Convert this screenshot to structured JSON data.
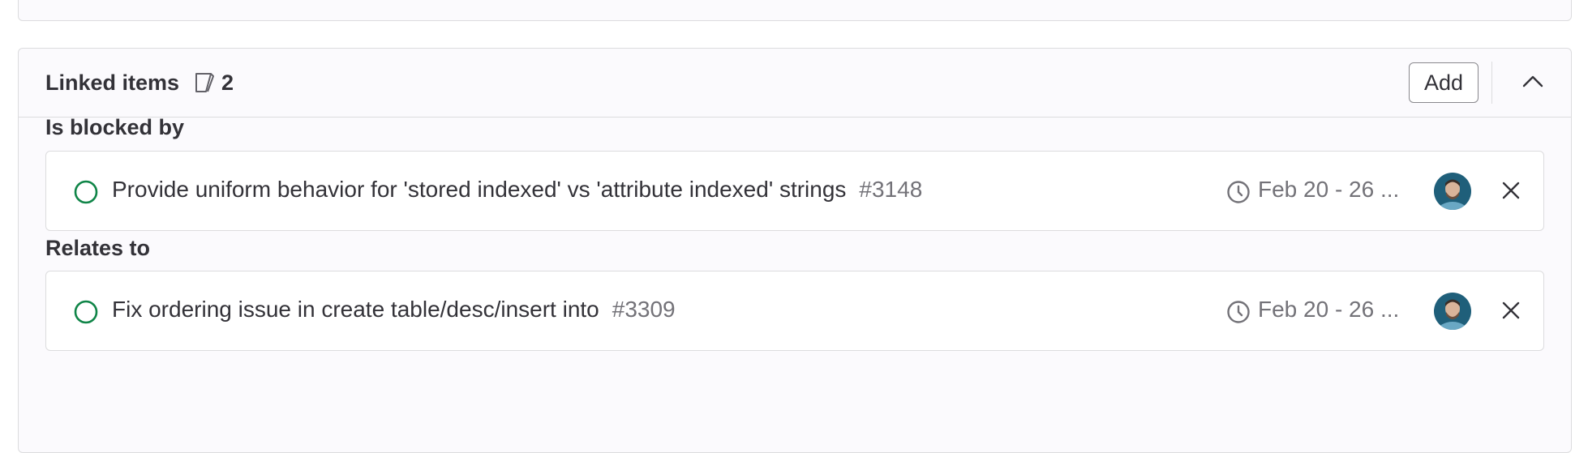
{
  "widget": {
    "title": "Linked items",
    "count": "2",
    "add_label": "Add",
    "count_icon": "issues-icon",
    "collapse_icon": "chevron-up-icon"
  },
  "sections": [
    {
      "title": "Is blocked by",
      "items": [
        {
          "title": "Provide uniform behavior for 'stored indexed' vs 'attribute indexed' strings",
          "reference": "#3148",
          "date": "Feb 20 - 26 ...",
          "status": "open",
          "status_color": "#108548"
        }
      ]
    },
    {
      "title": "Relates to",
      "items": [
        {
          "title": "Fix ordering issue in create table/desc/insert into",
          "reference": "#3309",
          "date": "Feb 20 - 26 ...",
          "status": "open",
          "status_color": "#108548"
        }
      ]
    }
  ],
  "colors": {
    "open_status": "#108548",
    "muted_text": "#737278",
    "border": "#dcdcde",
    "panel_bg": "#fbfafd"
  }
}
